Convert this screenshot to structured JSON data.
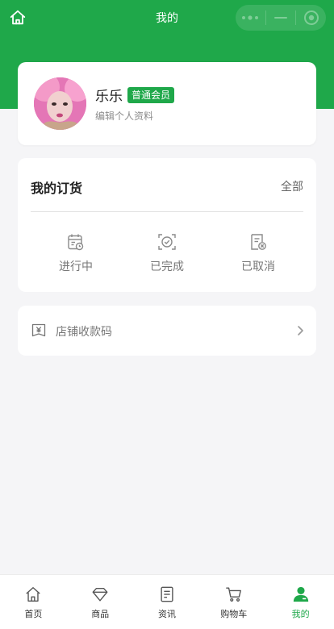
{
  "theme": {
    "accent": "#1fa84a",
    "background": "#f5f5f7",
    "muted_text": "#777777"
  },
  "topbar": {
    "title": "我的",
    "home_icon": "home-icon",
    "capsule_icons": [
      "more-icon",
      "minimize-icon",
      "close-circle-icon"
    ]
  },
  "profile": {
    "name": "乐乐",
    "badge": "普通会员",
    "edit_label": "编辑个人资料",
    "avatar_icon": "user-avatar"
  },
  "orders": {
    "title": "我的订货",
    "all_label": "全部",
    "statuses": [
      {
        "label": "进行中",
        "icon": "calendar-clock-icon"
      },
      {
        "label": "已完成",
        "icon": "scan-check-icon"
      },
      {
        "label": "已取消",
        "icon": "document-cancel-icon"
      }
    ]
  },
  "store": {
    "label": "店铺收款码",
    "icon": "yen-tag-icon",
    "arrow_icon": "chevron-right-icon"
  },
  "tabbar": {
    "active_index": 4,
    "items": [
      {
        "label": "首页",
        "icon": "home-outline-icon"
      },
      {
        "label": "商品",
        "icon": "diamond-icon"
      },
      {
        "label": "资讯",
        "icon": "news-document-icon"
      },
      {
        "label": "购物车",
        "icon": "cart-icon"
      },
      {
        "label": "我的",
        "icon": "person-filled-icon"
      }
    ]
  }
}
